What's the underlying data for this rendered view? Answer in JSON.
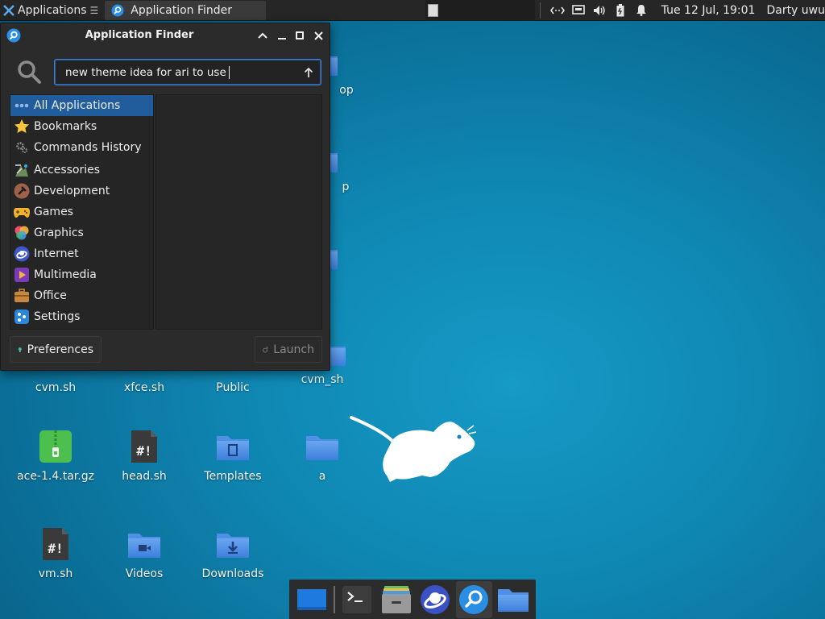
{
  "top_panel": {
    "applications_label": "Applications",
    "task_label": "Application Finder",
    "clock": "Tue 12 Jul, 19:01",
    "user": "Darty uwu",
    "tray_icons": [
      "network-icon",
      "display-icon",
      "volume-icon",
      "battery-icon",
      "notification-icon"
    ]
  },
  "finder": {
    "title": "Application Finder",
    "search_value": "new theme idea for ari to use",
    "categories": [
      {
        "label": "All Applications",
        "icon": "all-apps-icon",
        "selected": true
      },
      {
        "label": "Bookmarks",
        "icon": "star-icon"
      },
      {
        "label": "Commands History",
        "icon": "gear-icon"
      },
      {
        "label": "Accessories",
        "icon": "accessories-icon"
      },
      {
        "label": "Development",
        "icon": "hammer-icon"
      },
      {
        "label": "Games",
        "icon": "gamepad-icon"
      },
      {
        "label": "Graphics",
        "icon": "graphics-icon"
      },
      {
        "label": "Internet",
        "icon": "globe-icon"
      },
      {
        "label": "Multimedia",
        "icon": "multimedia-icon"
      },
      {
        "label": "Office",
        "icon": "briefcase-icon"
      },
      {
        "label": "Settings",
        "icon": "settings-icon"
      }
    ],
    "preferences_label": "Preferences",
    "launch_label": "Launch"
  },
  "desktop": {
    "icons": [
      {
        "label": "op",
        "type": "folder"
      },
      {
        "label": "p",
        "type": "folder"
      },
      {
        "label": "cvm.sh",
        "type": "script"
      },
      {
        "label": "xfce.sh",
        "type": "script"
      },
      {
        "label": "Public",
        "type": "folder"
      },
      {
        "label": "cvm_sh",
        "type": "folder"
      },
      {
        "label": "ace-1.4.tar.gz",
        "type": "archive"
      },
      {
        "label": "head.sh",
        "type": "script"
      },
      {
        "label": "Templates",
        "type": "folder"
      },
      {
        "label": "a",
        "type": "folder"
      },
      {
        "label": "vm.sh",
        "type": "script"
      },
      {
        "label": "Videos",
        "type": "folder"
      },
      {
        "label": "Downloads",
        "type": "folder"
      }
    ]
  },
  "dock": {
    "items": [
      "show-desktop-icon",
      "terminal-icon",
      "file-manager-icon",
      "web-browser-icon",
      "app-finder-icon",
      "folder-icon"
    ]
  },
  "colors": {
    "desktop_bg": "#0f86b2",
    "panel_bg": "#262626",
    "window_bg": "#2b2b2b",
    "selection": "#215d9c",
    "accent": "#3f7ccc"
  }
}
